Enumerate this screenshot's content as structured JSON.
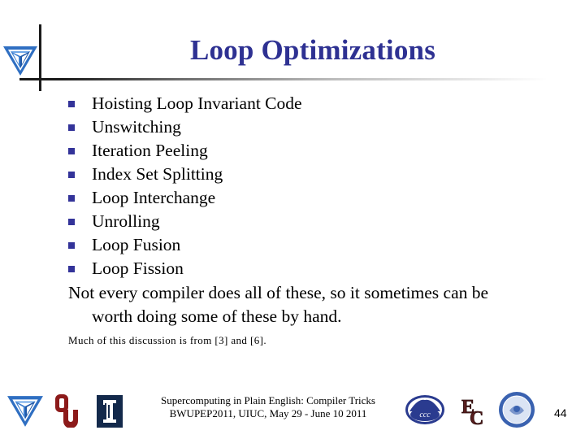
{
  "slide": {
    "title": "Loop Optimizations",
    "bullets": [
      "Hoisting Loop Invariant Code",
      "Unswitching",
      "Iteration Peeling",
      "Index Set Splitting",
      "Loop Interchange",
      "Unrolling",
      "Loop Fusion",
      "Loop Fission"
    ],
    "note_line1": "Not every compiler does all of these, so it sometimes can be",
    "note_line2": "worth doing some of these by hand.",
    "source": "Much of this discussion is from [3] and [6]."
  },
  "footer": {
    "line1": "Supercomputing in Plain English: Compiler Tricks",
    "line2": "BWUPEP2011, UIUC, May 29 - June 10 2011",
    "page_number": "44",
    "logos": [
      "oscer-triangle-logo",
      "ou-logo",
      "illinois-logo",
      "ccc-logo",
      "ec-logo",
      "seal-logo"
    ]
  },
  "colors": {
    "title": "#2e3192",
    "bullet": "#333399",
    "ou_crimson": "#8c1a1a",
    "illinois_navy": "#13294b",
    "oscer_blue": "#2f6fc2"
  }
}
